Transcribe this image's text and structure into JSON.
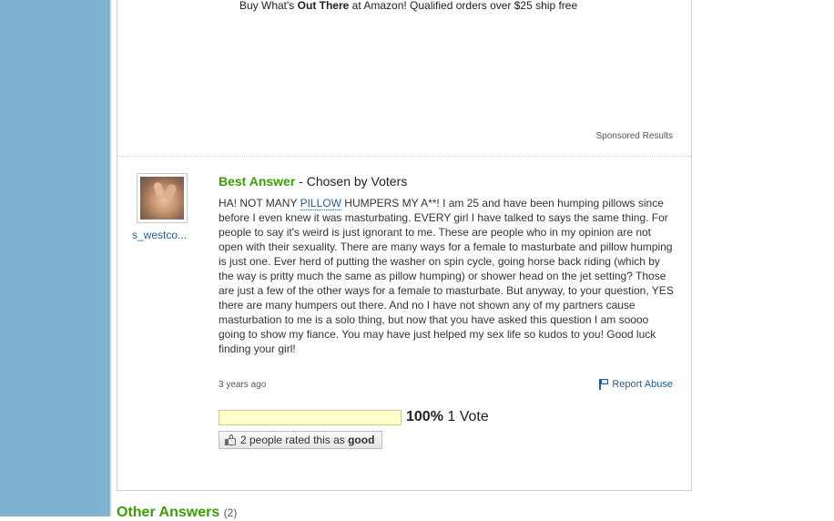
{
  "sponsored": {
    "amazon_prefix": "Buy What's ",
    "amazon_bold": "Out There",
    "amazon_suffix": " at Amazon! Qualified orders over $25 ship free",
    "label": "Sponsored Results"
  },
  "answer": {
    "username": "s_westco...",
    "heading": "Best Answer",
    "heading_suffix": " - Chosen by Voters",
    "body_pre": "HA! NOT MANY ",
    "body_link": "PILLOW",
    "body_post": " HUMPERS MY A**! I am 25 and have been humping pillows since before I even knew it was masturbating. EVERY girl I have talked to says the same thing. For people to say it's weird is just ignorant to me. These are people who in my opinion are not open with their sexuality. There are many ways for a female to masturbate and pillow humping is just one. Ever herd of putting the washer on spin cycle, going horse back riding (which by the way is pritty much the same as pillow humping) or shower head on the jet setting? Those are just a few of the other ways for a female to masturbate. But anyway, to your question, YES there are many humpers out there. And no I have not shown any of my partners cause masturbation to me is a solo thing, but now that you have asked this question I am soooo going to show my fiance. You may have just helped my sex life so kudos to you! Good luck finding your girl!",
    "timestamp": "3 years ago",
    "report_label": "Report Abuse"
  },
  "votes": {
    "percent_text": "100%",
    "percent_value": 100,
    "count_text": "1 Vote"
  },
  "rating": {
    "prefix": "2 people rated this as ",
    "bold": "good"
  },
  "other_answers": {
    "label": "Other Answers",
    "count": "(2)"
  },
  "colors": {
    "sidebar": "#7fb3cf",
    "accent_green": "#3a9f00",
    "link_blue": "#1d5e9c",
    "vote_bar": "#ffffcc"
  },
  "icons": [
    "flag-icon",
    "thumbs-up-icon"
  ]
}
